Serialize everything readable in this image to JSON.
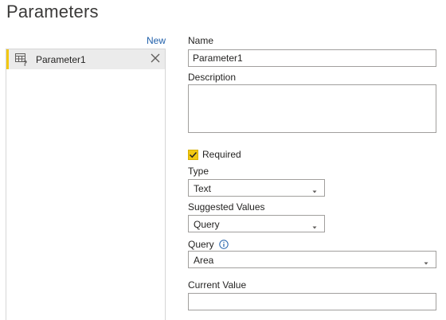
{
  "title": "Parameters",
  "new_link": "New",
  "parameters_list": [
    {
      "label": "Parameter1"
    }
  ],
  "form": {
    "name_label": "Name",
    "name_value": "Parameter1",
    "description_label": "Description",
    "description_value": "",
    "required_label": "Required",
    "required_checked": true,
    "type_label": "Type",
    "type_value": "Text",
    "suggested_label": "Suggested Values",
    "suggested_value": "Query",
    "query_label": "Query",
    "query_value": "Area",
    "current_label": "Current Value",
    "current_value": ""
  },
  "colors": {
    "accent": "#f2c811",
    "link": "#1f5faa",
    "selected_bg": "#ebebeb",
    "border": "#a19f9d"
  },
  "icons": {
    "parameter": "parameter-table-question-icon",
    "close": "close-icon",
    "dropdown": "chevron-down-icon",
    "info": "info-icon",
    "check": "checkmark-icon"
  }
}
